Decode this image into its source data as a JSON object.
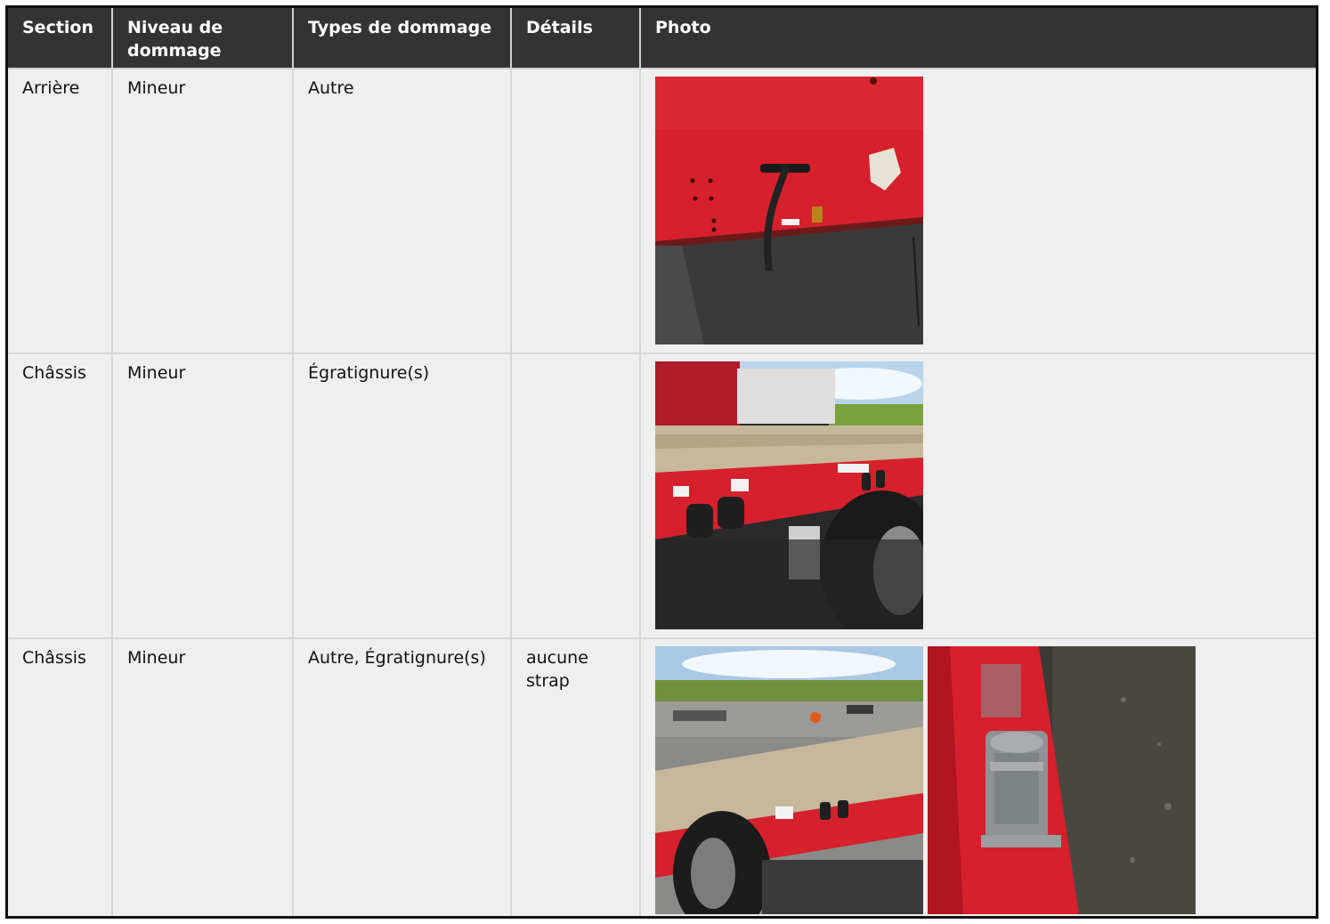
{
  "table": {
    "headers": {
      "section": "Section",
      "level": "Niveau de dommage",
      "types": "Types de dommage",
      "details": "Détails",
      "photo": "Photo"
    },
    "rows": [
      {
        "section": "Arrière",
        "level": "Mineur",
        "types": "Autre",
        "details": "",
        "photos": [
          "rear-panel-hose-photo"
        ]
      },
      {
        "section": "Châssis",
        "level": "Mineur",
        "types": "Égratignure(s)",
        "details": "",
        "photos": [
          "chassis-scratch-photo"
        ]
      },
      {
        "section": "Châssis",
        "level": "Mineur",
        "types": "Autre, Égratignure(s)",
        "details": "aucune strap",
        "photos": [
          "flatbed-deck-photo",
          "winch-closeup-photo"
        ]
      }
    ]
  },
  "colors": {
    "header_bg": "#333333",
    "row_bg": "#efefef",
    "trailer_red": "#d8202c"
  }
}
